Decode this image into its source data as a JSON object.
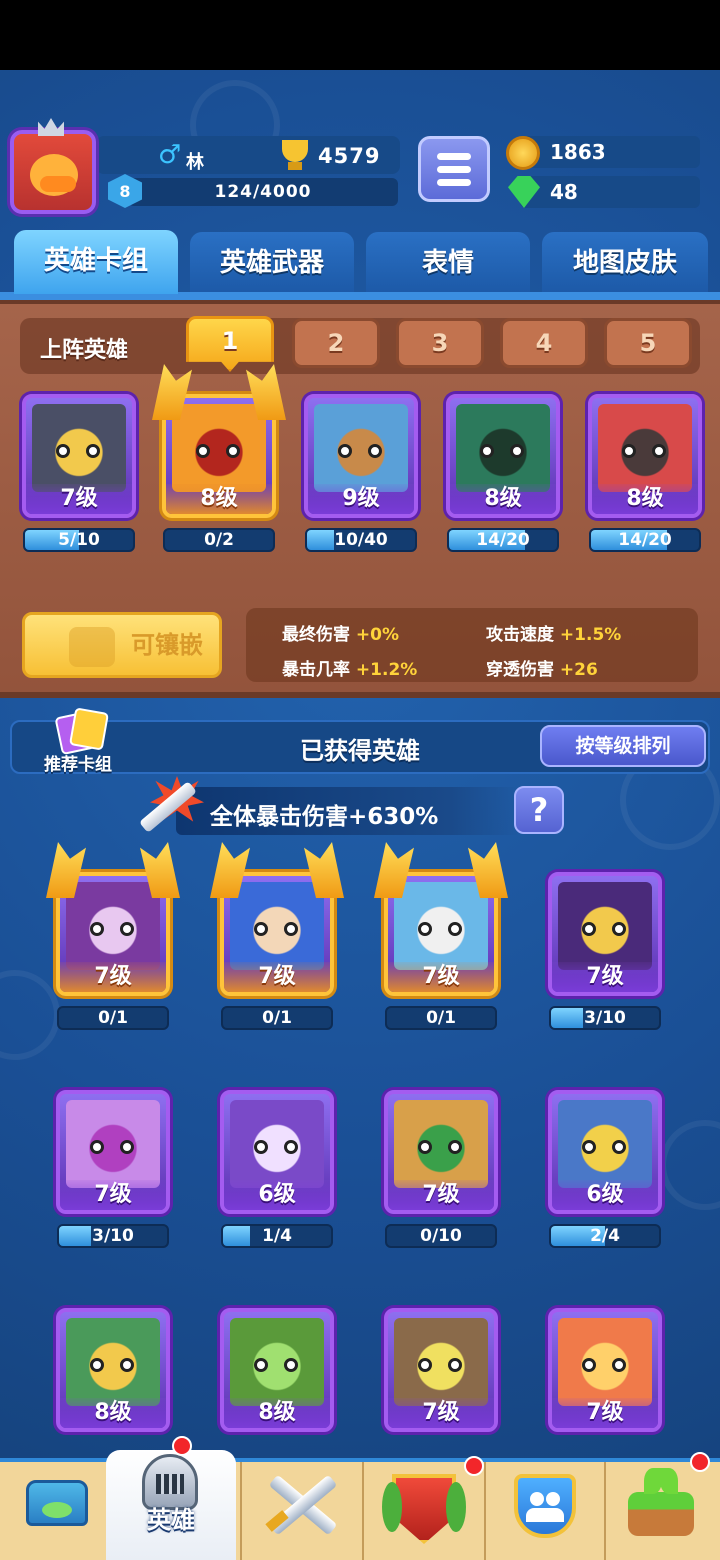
{
  "player": {
    "name": "林",
    "gender_symbol": "♂",
    "trophies": "4579",
    "level": "8",
    "xp": "124/4000"
  },
  "currency": {
    "gold": "1863",
    "gems": "48"
  },
  "tabs": [
    {
      "label": "英雄卡组",
      "active": true
    },
    {
      "label": "英雄武器",
      "active": false
    },
    {
      "label": "表情",
      "active": false
    },
    {
      "label": "地图皮肤",
      "active": false
    }
  ],
  "lineup": {
    "label": "上阵英雄",
    "slots": [
      "1",
      "2",
      "3",
      "4",
      "5"
    ],
    "active_slot": "1",
    "heroes": [
      {
        "level": "7级",
        "progress": "5/10",
        "fill": 0.5,
        "rarity": "epic"
      },
      {
        "level": "8级",
        "progress": "0/2",
        "fill": 0.0,
        "rarity": "legendary"
      },
      {
        "level": "9级",
        "progress": "10/40",
        "fill": 0.25,
        "rarity": "epic"
      },
      {
        "level": "8级",
        "progress": "14/20",
        "fill": 0.7,
        "rarity": "epic"
      },
      {
        "level": "8级",
        "progress": "14/20",
        "fill": 0.7,
        "rarity": "epic"
      }
    ]
  },
  "inlay_button": "可镶嵌",
  "stats": [
    {
      "label": "最终伤害",
      "value": "+0%"
    },
    {
      "label": "攻击速度",
      "value": "+1.5%"
    },
    {
      "label": "暴击几率",
      "value": "+1.2%"
    },
    {
      "label": "穿透伤害",
      "value": "+26"
    }
  ],
  "collection": {
    "recommend_label": "推荐卡组",
    "title": "已获得英雄",
    "sort_button": "按等级排列",
    "crit_bonus": "全体暴击伤害+630%",
    "help": "?",
    "heroes": [
      {
        "level": "7级",
        "progress": "0/1",
        "fill": 0.0,
        "rarity": "legendary"
      },
      {
        "level": "7级",
        "progress": "0/1",
        "fill": 0.0,
        "rarity": "legendary"
      },
      {
        "level": "7级",
        "progress": "0/1",
        "fill": 0.0,
        "rarity": "legendary"
      },
      {
        "level": "7级",
        "progress": "3/10",
        "fill": 0.3,
        "rarity": "epic"
      },
      {
        "level": "7级",
        "progress": "3/10",
        "fill": 0.3,
        "rarity": "epic"
      },
      {
        "level": "6级",
        "progress": "1/4",
        "fill": 0.25,
        "rarity": "epic"
      },
      {
        "level": "7级",
        "progress": "0/10",
        "fill": 0.0,
        "rarity": "epic"
      },
      {
        "level": "6级",
        "progress": "2/4",
        "fill": 0.5,
        "rarity": "epic"
      },
      {
        "level": "8级",
        "rarity": "epic"
      },
      {
        "level": "8级",
        "rarity": "epic"
      },
      {
        "level": "7级",
        "rarity": "epic"
      },
      {
        "level": "7级",
        "rarity": "epic"
      }
    ]
  },
  "nav": {
    "items": [
      {
        "name": "treasure-chest-icon"
      },
      {
        "name": "hero-helmet-icon",
        "label": "英雄",
        "active": true,
        "badge": true
      },
      {
        "name": "crossed-swords-icon"
      },
      {
        "name": "shield-crown-icon",
        "badge": true
      },
      {
        "name": "friends-icon"
      },
      {
        "name": "sprout-island-icon",
        "badge": true
      }
    ]
  },
  "colors": {
    "background": "#1b4f96",
    "epic_border": "#a45cf0",
    "legendary_border": "#ffc43a",
    "stat_value": "#ffd33a",
    "wood_panel": "#a5644a"
  }
}
